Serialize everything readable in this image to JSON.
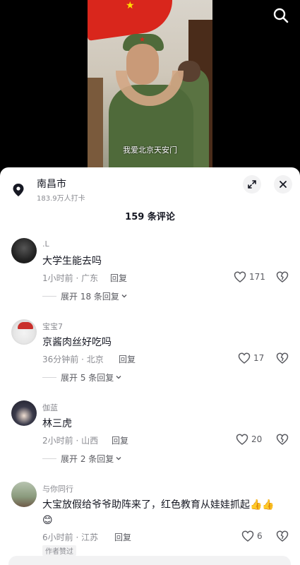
{
  "video": {
    "caption": "我爱北京天安门"
  },
  "location": {
    "name": "南昌市",
    "checkins": "183.9万人打卡"
  },
  "comments_header": {
    "title": "159 条评论"
  },
  "comments": [
    {
      "user": ".L",
      "text": "大学生能去吗",
      "meta": "1小时前 · 广东",
      "reply": "回复",
      "likes": "171",
      "expand": "展开 18 条回复"
    },
    {
      "user": "宝宝7",
      "text": "京酱肉丝好吃吗",
      "meta": "36分钟前 · 北京",
      "reply": "回复",
      "likes": "17",
      "expand": "展开 5 条回复"
    },
    {
      "user": "伽蓝",
      "text": "林三虎",
      "meta": "2小时前 · 山西",
      "reply": "回复",
      "likes": "20",
      "expand": "展开 2 条回复"
    },
    {
      "user": "与你同行",
      "text": "大宝放假给爷爷助阵来了，红色教育从娃娃抓起👍👍",
      "text2": "😊",
      "meta": "6小时前 · 江苏",
      "reply": "回复",
      "likes": "6",
      "tag": "作者赞过"
    }
  ],
  "icons": {
    "search": "search-icon",
    "location": "location-pin-icon",
    "expand": "expand-icon",
    "close": "close-icon",
    "like": "heart-icon",
    "dislike": "broken-heart-icon",
    "chevron": "chevron-down-icon"
  },
  "colors": {
    "text_primary": "#161823",
    "text_secondary": "#8a8b91",
    "flag_red": "#d9261c"
  }
}
